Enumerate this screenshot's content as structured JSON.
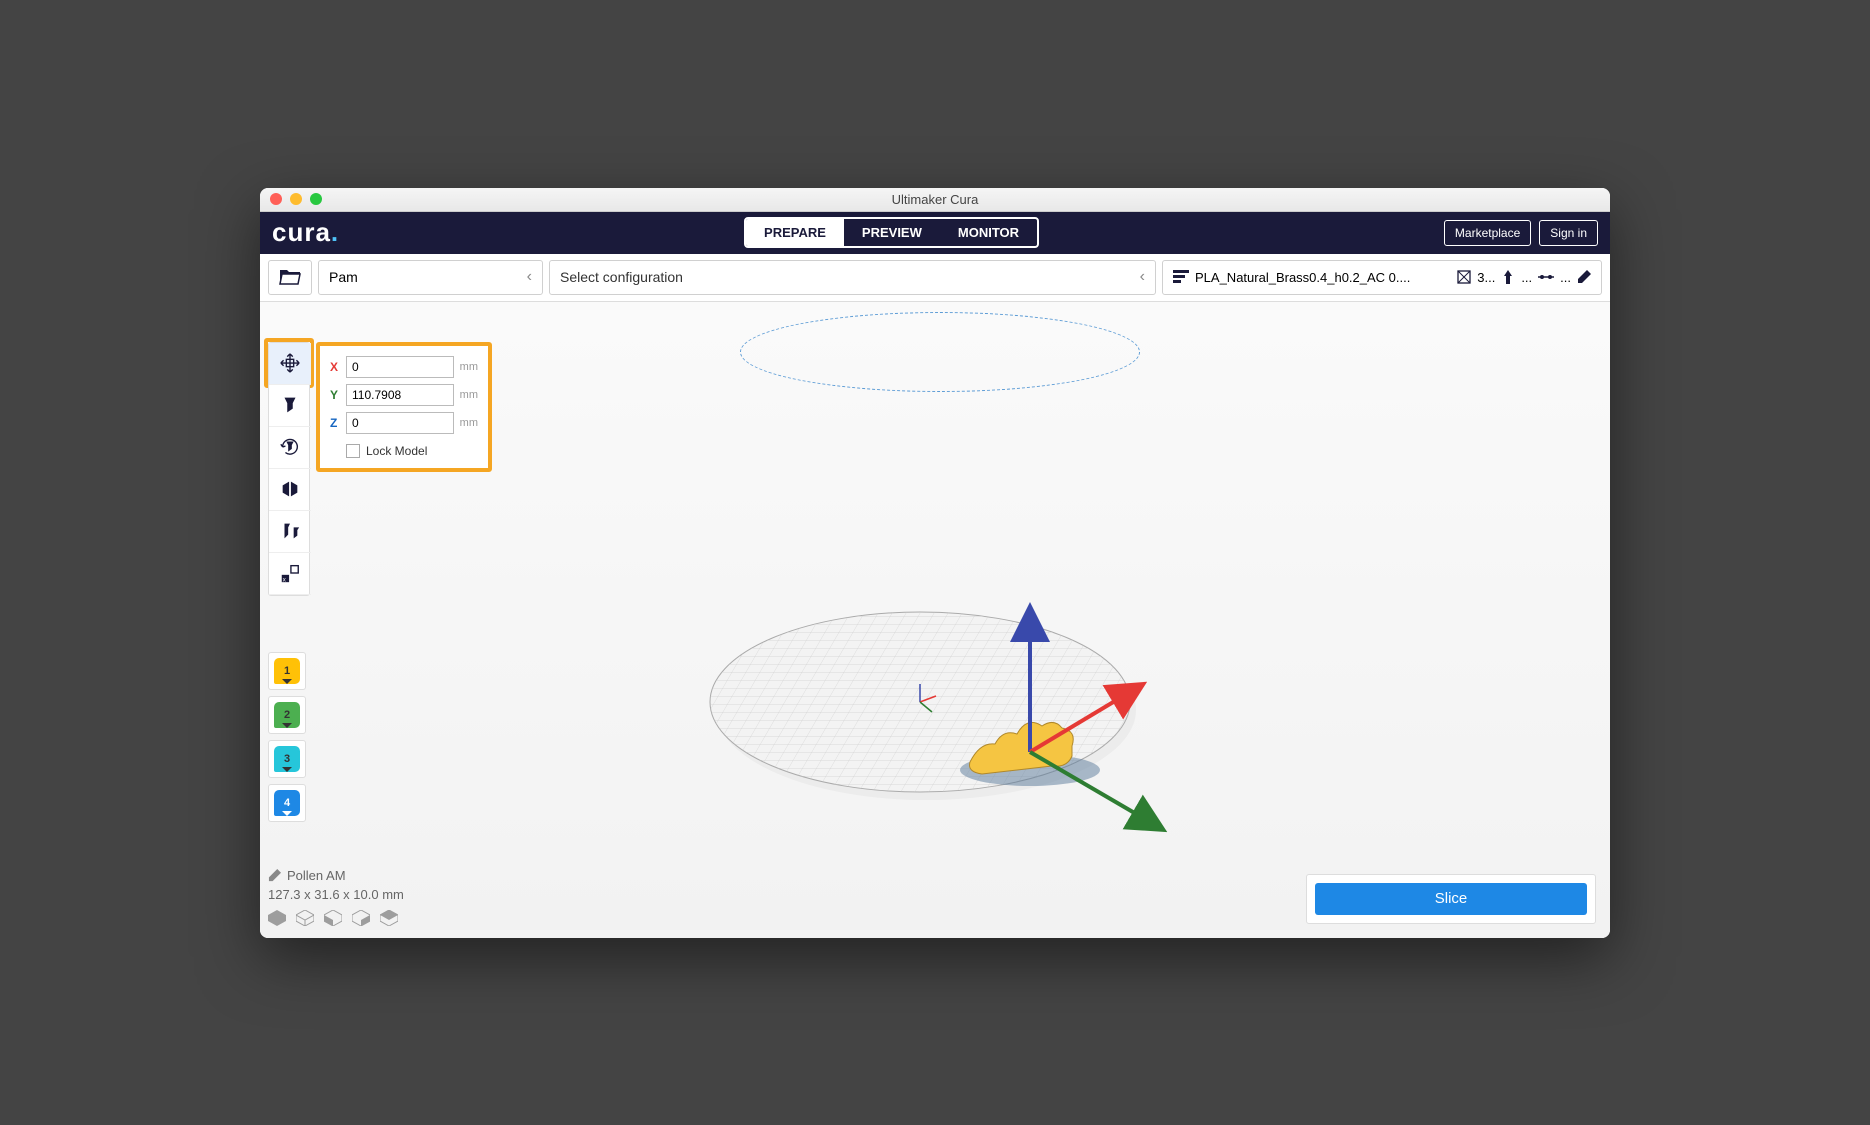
{
  "window_title": "Ultimaker Cura",
  "logo_text": "cura",
  "tabs": {
    "prepare": "PREPARE",
    "preview": "PREVIEW",
    "monitor": "MONITOR"
  },
  "header_buttons": {
    "marketplace": "Marketplace",
    "signin": "Sign in"
  },
  "subheader": {
    "printer": "Pam",
    "config": "Select configuration",
    "profile": "PLA_Natural_Brass0.4_h0.2_AC 0....",
    "infill": "3...",
    "more": "..."
  },
  "move_panel": {
    "x_label": "X",
    "x_value": "0",
    "y_label": "Y",
    "y_value": "110.7908",
    "z_label": "Z",
    "z_value": "0",
    "unit": "mm",
    "lock": "Lock Model"
  },
  "extruders": [
    "1",
    "2",
    "3",
    "4"
  ],
  "model": {
    "name": "Pollen AM",
    "dimensions": "127.3 x 31.6 x 10.0 mm"
  },
  "slice": "Slice"
}
